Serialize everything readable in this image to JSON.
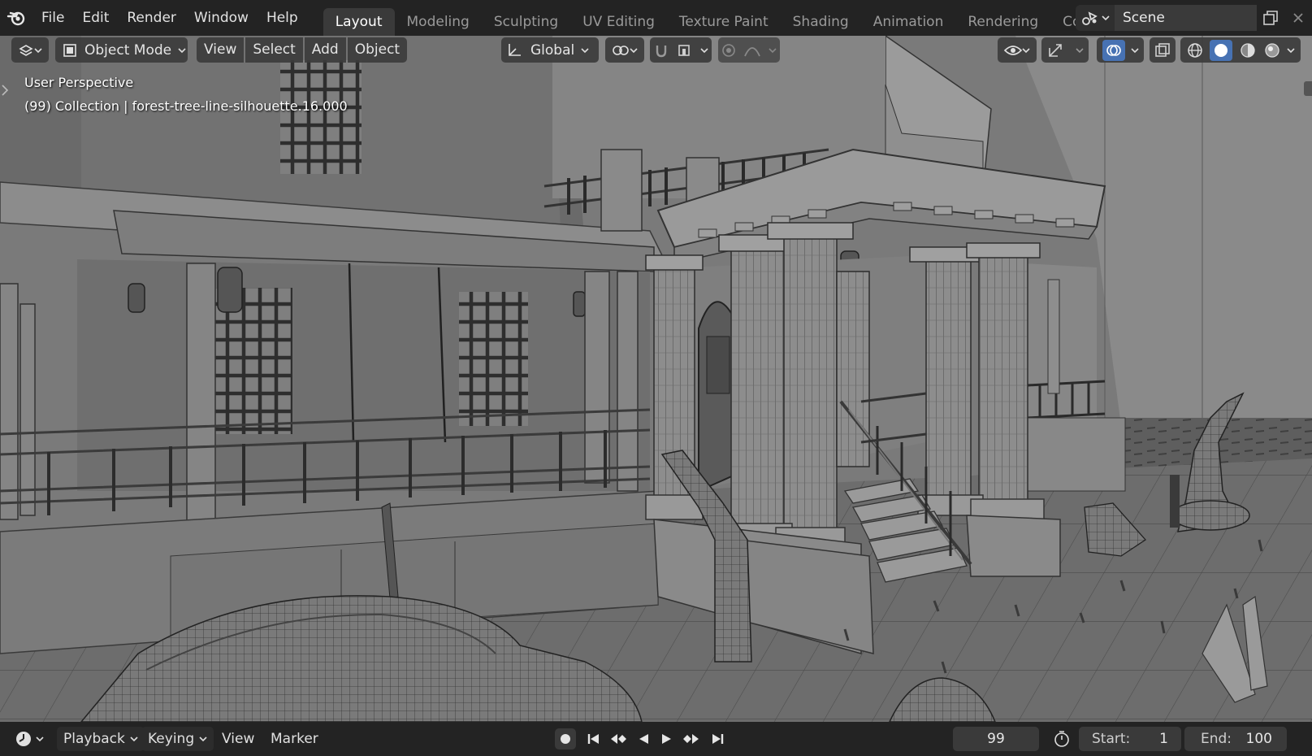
{
  "app": {
    "name": "Blender"
  },
  "menu": {
    "items": [
      {
        "label": "File"
      },
      {
        "label": "Edit"
      },
      {
        "label": "Render"
      },
      {
        "label": "Window"
      },
      {
        "label": "Help"
      }
    ]
  },
  "workspace_tabs": [
    {
      "label": "Layout",
      "active": true
    },
    {
      "label": "Modeling",
      "active": false
    },
    {
      "label": "Sculpting",
      "active": false
    },
    {
      "label": "UV Editing",
      "active": false
    },
    {
      "label": "Texture Paint",
      "active": false
    },
    {
      "label": "Shading",
      "active": false
    },
    {
      "label": "Animation",
      "active": false
    },
    {
      "label": "Rendering",
      "active": false
    },
    {
      "label": "Compos",
      "active": false
    }
  ],
  "scene": {
    "name": "Scene"
  },
  "viewport_header": {
    "mode": "Object Mode",
    "menus": [
      "View",
      "Select",
      "Add",
      "Object"
    ],
    "transform_orientation": "Global"
  },
  "viewport": {
    "perspective_label": "User Perspective",
    "collection_label": "(99) Collection | forest-tree-line-silhouette.16.000"
  },
  "timeline": {
    "playback_label": "Playback",
    "keying_label": "Keying",
    "view_label": "View",
    "marker_label": "Marker",
    "current_frame": "99",
    "start_label": "Start:",
    "start_value": "1",
    "end_label": "End:",
    "end_value": "100"
  },
  "colors": {
    "topbar_bg": "#232323",
    "active_tab_bg": "#3a3a3a",
    "viewport_bg": "#6f6f6f",
    "accent_blue": "#4772b3"
  }
}
